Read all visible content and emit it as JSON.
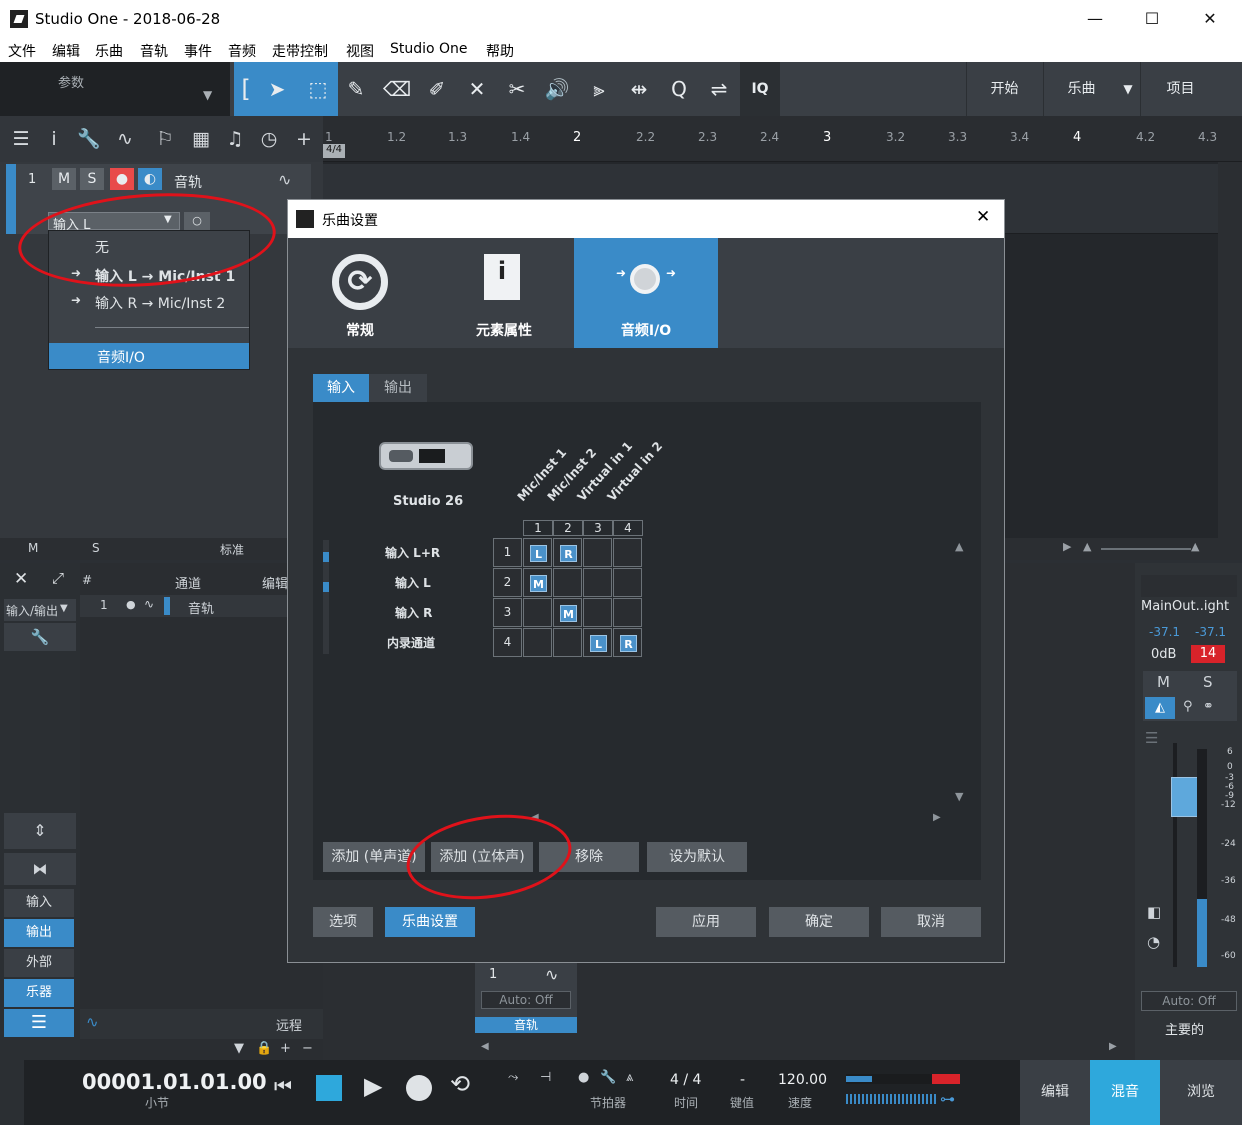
{
  "window": {
    "title": "Studio One - 2018-06-28",
    "minimize": "—",
    "maximize": "☐",
    "close": "✕"
  },
  "menu": [
    "文件",
    "编辑",
    "乐曲",
    "音轨",
    "事件",
    "音频",
    "走带控制",
    "视图",
    "Studio One",
    "帮助"
  ],
  "toolbar": {
    "params_label": "参数",
    "iq_label": "IQ",
    "start_label": "开始",
    "song_label": "乐曲",
    "project_label": "项目"
  },
  "ruler": {
    "ticks": [
      "1",
      "1.2",
      "1.3",
      "1.4",
      "2",
      "2.2",
      "2.3",
      "2.4",
      "3",
      "3.2",
      "3.3",
      "3.4",
      "4",
      "4.2",
      "4.3"
    ],
    "time_sig": "4/4"
  },
  "track": {
    "number": "1",
    "mute": "M",
    "solo": "S",
    "name": "音轨",
    "input": "输入 L",
    "footer_m": "M",
    "footer_s": "S",
    "footer_std": "标准"
  },
  "dropdown": {
    "items": [
      "无",
      "输入 L → Mic/Inst 1",
      "输入 R → Mic/Inst 2"
    ],
    "selected": "音频I/O"
  },
  "channels": {
    "col_hash": "#",
    "col_channel": "通道",
    "col_edit": "编辑",
    "io_label": "输入/输出",
    "row_num": "1",
    "row_name": "音轨"
  },
  "mixer_nav": {
    "input": "输入",
    "output": "输出",
    "external": "外部",
    "instrument": "乐器",
    "remote": "远程"
  },
  "channel_strip": {
    "number": "1",
    "auto": "Auto: Off",
    "name": "音轨"
  },
  "main_out": {
    "name": "MainOut..ight",
    "peak_l": "-37.1",
    "peak_r": "-37.1",
    "gain": "0dB",
    "pan": "14",
    "m": "M",
    "s": "S",
    "auto": "Auto: Off",
    "label": "主要的",
    "scale": [
      "6",
      "0",
      "-3",
      "-6",
      "-9",
      "-12",
      "-24",
      "-36",
      "-48",
      "-60"
    ]
  },
  "transport": {
    "position": "00001.01.01.00",
    "position_label": "小节",
    "metronome": "节拍器",
    "time_sig": "4 / 4",
    "time_label": "时间",
    "key": "-",
    "key_label": "键值",
    "tempo": "120.00",
    "tempo_label": "速度",
    "edit": "编辑",
    "mix": "混音",
    "browse": "浏览"
  },
  "dialog": {
    "title": "乐曲设置",
    "tabs": [
      "常规",
      "元素属性",
      "音频I/O"
    ],
    "subtabs": [
      "输入",
      "输出"
    ],
    "device": "Studio 26",
    "columns": [
      "Mic/Inst 1",
      "Mic/Inst 2",
      "Virtual in 1",
      "Virtual in 2"
    ],
    "col_nums": [
      "1",
      "2",
      "3",
      "4"
    ],
    "rows": [
      {
        "name": "输入 L+R",
        "num": "1",
        "cells": [
          "L",
          "R",
          "",
          ""
        ]
      },
      {
        "name": "输入 L",
        "num": "2",
        "cells": [
          "M",
          "",
          "",
          ""
        ]
      },
      {
        "name": "输入 R",
        "num": "3",
        "cells": [
          "",
          "M",
          "",
          ""
        ]
      },
      {
        "name": "内录通道",
        "num": "4",
        "cells": [
          "",
          "",
          "L",
          "R"
        ]
      }
    ],
    "buttons": {
      "add_mono": "添加 (单声道)",
      "add_stereo": "添加 (立体声)",
      "remove": "移除",
      "set_default": "设为默认"
    },
    "footer": {
      "options": "选项",
      "song_setup": "乐曲设置",
      "apply": "应用",
      "ok": "确定",
      "cancel": "取消"
    }
  },
  "colors": {
    "accent": "#3a8bc8",
    "annotation": "#e0121a",
    "record": "#e84a4a"
  }
}
